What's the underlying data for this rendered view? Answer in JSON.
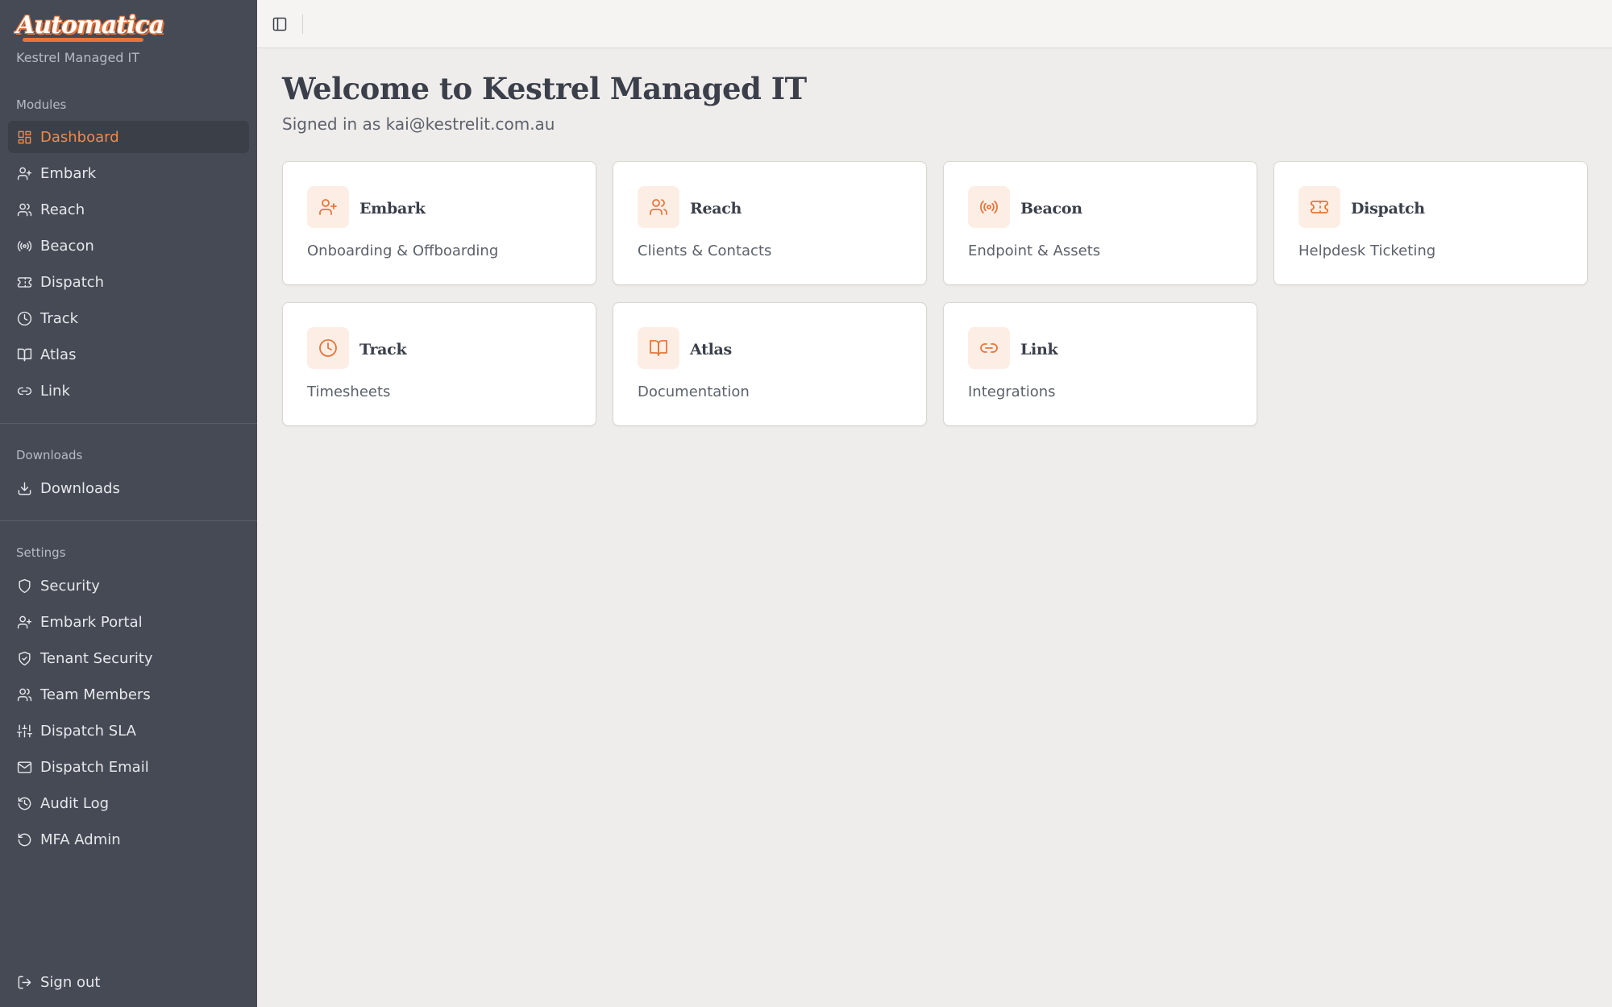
{
  "brand": {
    "logo_text": "Automatica",
    "tenant": "Kestrel Managed IT"
  },
  "colors": {
    "accent": "#e8743b",
    "sidebar_bg": "#454a55",
    "page_bg": "#efedeb"
  },
  "sidebar": {
    "modules_label": "Modules",
    "modules": [
      {
        "label": "Dashboard",
        "icon": "dashboard-icon",
        "active": true
      },
      {
        "label": "Embark",
        "icon": "user-plus-icon"
      },
      {
        "label": "Reach",
        "icon": "users-icon"
      },
      {
        "label": "Beacon",
        "icon": "radio-icon"
      },
      {
        "label": "Dispatch",
        "icon": "ticket-icon"
      },
      {
        "label": "Track",
        "icon": "clock-icon"
      },
      {
        "label": "Atlas",
        "icon": "book-icon"
      },
      {
        "label": "Link",
        "icon": "link-icon"
      }
    ],
    "downloads_label": "Downloads",
    "downloads": [
      {
        "label": "Downloads",
        "icon": "download-icon"
      }
    ],
    "settings_label": "Settings",
    "settings": [
      {
        "label": "Security",
        "icon": "shield-icon"
      },
      {
        "label": "Embark Portal",
        "icon": "user-plus-icon"
      },
      {
        "label": "Tenant Security",
        "icon": "shield-check-icon"
      },
      {
        "label": "Team Members",
        "icon": "users-icon"
      },
      {
        "label": "Dispatch SLA",
        "icon": "sliders-icon"
      },
      {
        "label": "Dispatch Email",
        "icon": "mail-icon"
      },
      {
        "label": "Audit Log",
        "icon": "history-icon"
      },
      {
        "label": "MFA Admin",
        "icon": "rotate-icon"
      }
    ],
    "sign_out": {
      "label": "Sign out",
      "icon": "log-out-icon"
    }
  },
  "main": {
    "title": "Welcome to Kestrel Managed IT",
    "subtitle": "Signed in as kai@kestrelit.com.au",
    "cards": [
      {
        "title": "Embark",
        "desc": "Onboarding & Offboarding",
        "icon": "user-plus-icon"
      },
      {
        "title": "Reach",
        "desc": "Clients & Contacts",
        "icon": "users-icon"
      },
      {
        "title": "Beacon",
        "desc": "Endpoint & Assets",
        "icon": "radio-icon"
      },
      {
        "title": "Dispatch",
        "desc": "Helpdesk Ticketing",
        "icon": "ticket-icon"
      },
      {
        "title": "Track",
        "desc": "Timesheets",
        "icon": "clock-icon"
      },
      {
        "title": "Atlas",
        "desc": "Documentation",
        "icon": "book-icon"
      },
      {
        "title": "Link",
        "desc": "Integrations",
        "icon": "link-icon"
      }
    ]
  }
}
